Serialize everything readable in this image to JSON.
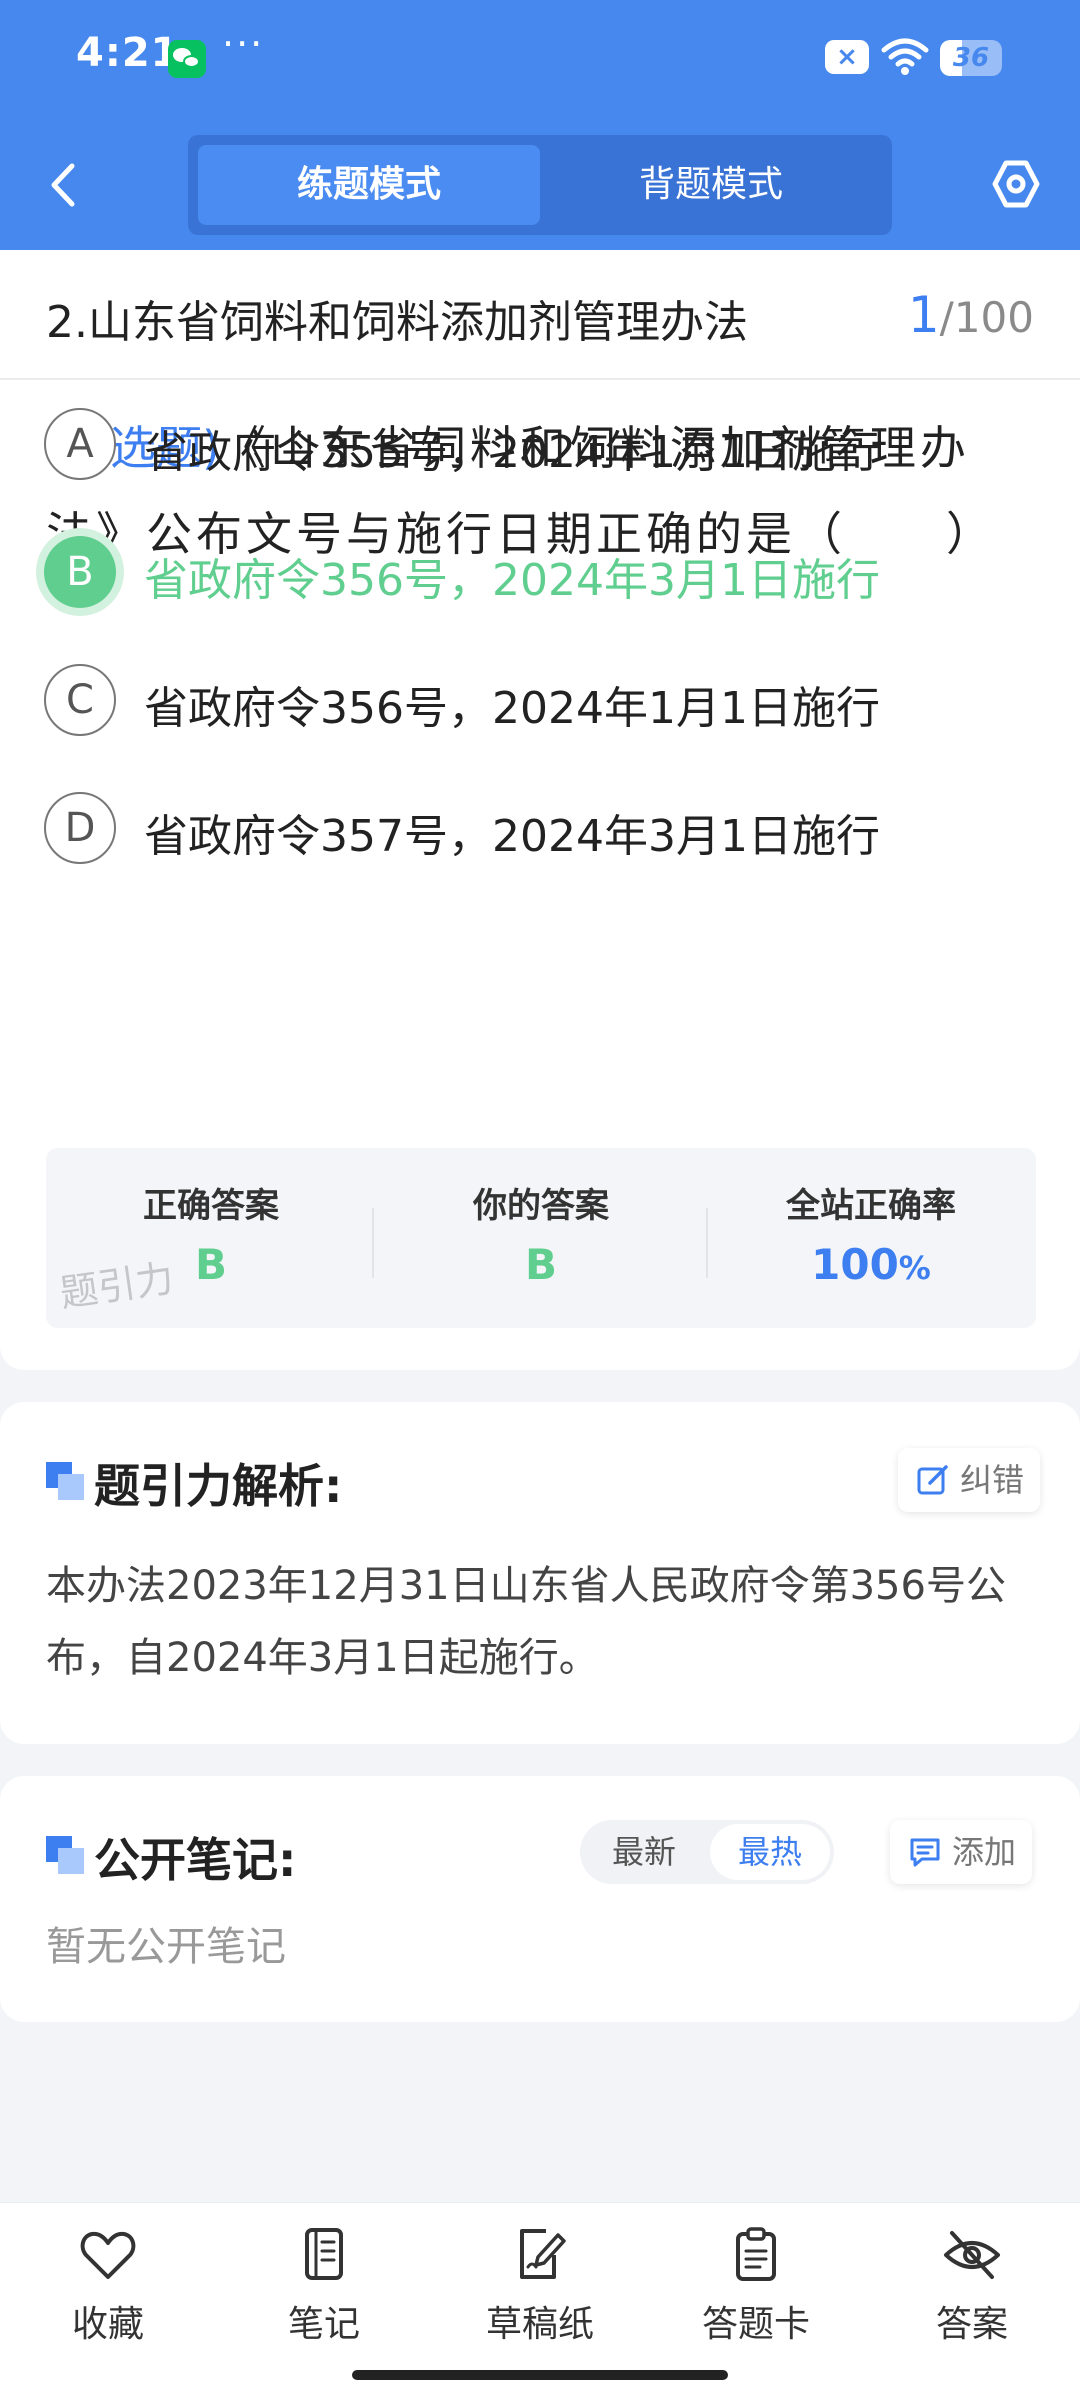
{
  "status_bar": {
    "time": "4:21",
    "battery_level": "36",
    "battery_fill": 0.36,
    "icons": [
      "wechat-icon",
      "more-dots-icon",
      "close-icon",
      "wifi-icon",
      "battery-icon"
    ]
  },
  "nav": {
    "back_icon": "chevron-left-icon",
    "tabs": [
      {
        "label": "练题模式",
        "active": true
      },
      {
        "label": "背题模式",
        "active": false
      }
    ],
    "settings_icon": "hexagon-settings-icon"
  },
  "question": {
    "section_title": "2.山东省饲料和饲料添加剂管理办法",
    "current": "1",
    "separator": "/",
    "total": "100",
    "type": "(单选题)",
    "text": "《山东省饲料和饲料添加剂管理办法》公布文号与施行日期正确的是（　　）",
    "options": [
      {
        "letter": "A",
        "text": "省政府令355号，2024年1月1日施行",
        "state": "normal"
      },
      {
        "letter": "B",
        "text": "省政府令356号，2024年3月1日施行",
        "state": "correct"
      },
      {
        "letter": "C",
        "text": "省政府令356号，2024年1月1日施行",
        "state": "normal"
      },
      {
        "letter": "D",
        "text": "省政府令357号，2024年3月1日施行",
        "state": "normal"
      }
    ]
  },
  "answer_summary": {
    "correct_label": "正确答案",
    "correct_value": "B",
    "yours_label": "你的答案",
    "yours_value": "B",
    "rate_label": "全站正确率",
    "rate_value": "100",
    "rate_unit": "%",
    "watermark": "题引力"
  },
  "analysis": {
    "title": "题引力解析:",
    "report_label": "纠错",
    "report_icon": "edit-icon",
    "body": "本办法2023年12月31日山东省人民政府令第356号公布，自2024年3月1日起施行。"
  },
  "notes": {
    "title": "公开笔记:",
    "sort_options": [
      {
        "label": "最新",
        "active": false
      },
      {
        "label": "最热",
        "active": true
      }
    ],
    "add_label": "添加",
    "add_icon": "comment-icon",
    "empty_text": "暂无公开笔记"
  },
  "bottom_bar": [
    {
      "label": "收藏",
      "icon": "heart-icon"
    },
    {
      "label": "笔记",
      "icon": "notebook-icon"
    },
    {
      "label": "草稿纸",
      "icon": "draft-paper-icon"
    },
    {
      "label": "答题卡",
      "icon": "answer-card-icon"
    },
    {
      "label": "答案",
      "icon": "eye-off-icon"
    }
  ],
  "colors": {
    "brand_blue": "#4688ee",
    "accent_blue": "#3d7ef0",
    "correct_green": "#5fce8e"
  }
}
